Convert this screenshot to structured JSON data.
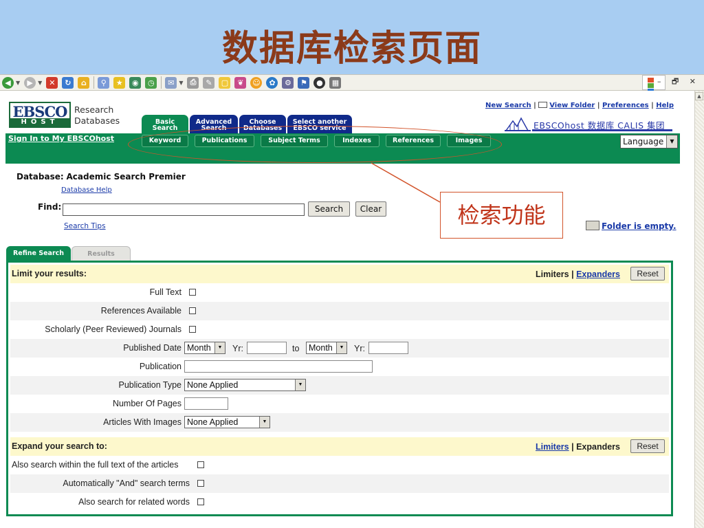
{
  "slide": {
    "title": "数据库检索页面"
  },
  "window": {
    "controls": "–  🗗  ✕"
  },
  "header": {
    "logo_top": "EBSCO",
    "logo_bottom": "HOST",
    "logo_line1": "Research",
    "logo_line2": "Databases",
    "links": [
      "New Search",
      "View Folder",
      "Preferences",
      "Help"
    ],
    "banner": "EBSCOhost 数据库 CALIS 集团"
  },
  "tabs": [
    {
      "line1": "Basic",
      "line2": "Search"
    },
    {
      "line1": "Advanced",
      "line2": "Search"
    },
    {
      "line1": "Choose",
      "line2": "Databases"
    },
    {
      "line1": "Select another",
      "line2": "EBSCO service"
    }
  ],
  "signin": "Sign In to My EBSCOhost",
  "subtabs": [
    "Keyword",
    "Publications",
    "Subject Terms",
    "Indexes",
    "References",
    "Images"
  ],
  "language": "Language",
  "database": {
    "label": "Database:",
    "name": "Academic Search Premier",
    "help": "Database Help"
  },
  "find": {
    "label": "Find:",
    "value": "",
    "search_label": "Search",
    "clear_label": "Clear",
    "tips": "Search Tips"
  },
  "callout": "检索功能",
  "folder": {
    "text": "Folder is empty."
  },
  "panel_tabs": {
    "refine": "Refine Search",
    "results": "Results"
  },
  "limiters": {
    "heading": "Limit your results:",
    "right_bold": "Limiters",
    "right_link": "Expanders",
    "reset": "Reset",
    "full_text": "Full Text",
    "references": "References Available",
    "scholarly": "Scholarly (Peer Reviewed) Journals",
    "published_date": "Published Date",
    "month": "Month",
    "yr": "Yr:",
    "to": "to",
    "publication": "Publication",
    "publication_type": "Publication Type",
    "publication_type_value": "None Applied",
    "pages": "Number Of Pages",
    "images": "Articles With Images",
    "images_value": "None Applied"
  },
  "expanders": {
    "heading": "Expand your search to:",
    "right_link": "Limiters",
    "right_bold": "Expanders",
    "reset": "Reset",
    "fulltext": "Also search within the full text of the articles",
    "and_terms": "Automatically \"And\" search terms",
    "related": "Also search for related words"
  },
  "colors": {
    "ebsco_green": "#0c8a52",
    "tab_blue": "#102a8a",
    "link_blue": "#1a3aa8",
    "callout_red": "#d2532a",
    "slide_bg": "#a8cdf2"
  }
}
